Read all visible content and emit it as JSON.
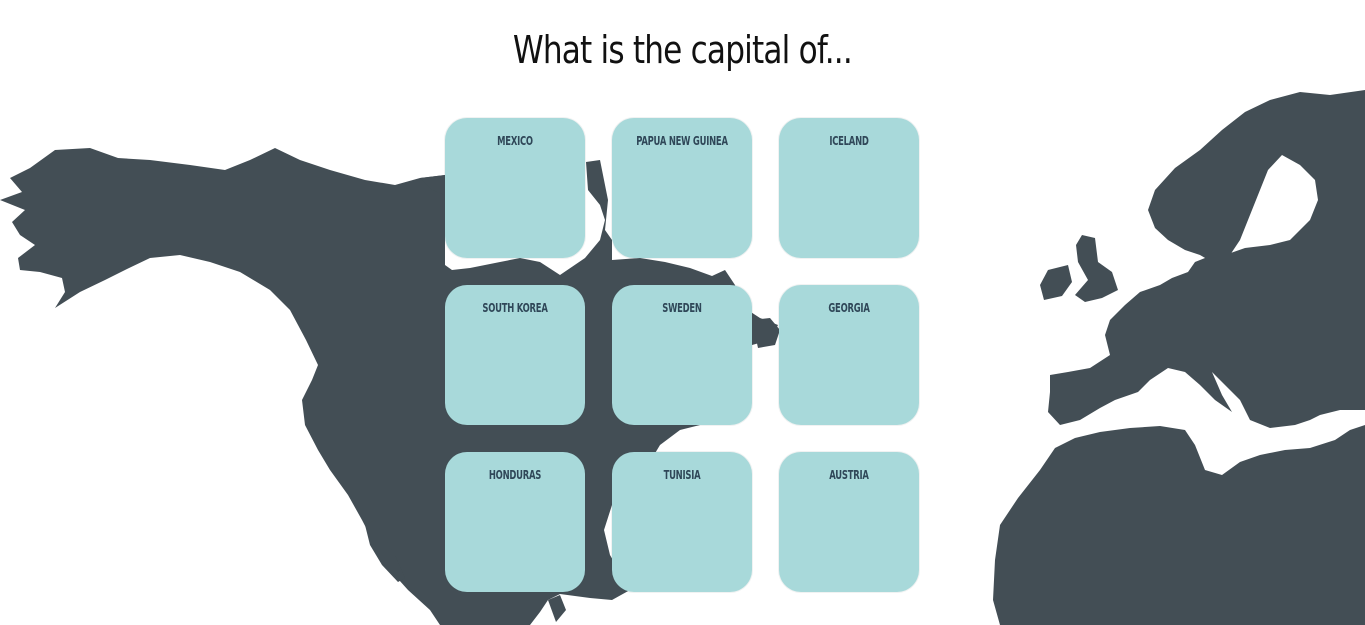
{
  "question": {
    "title": "What is the capital of..."
  },
  "countries": [
    "Mexico",
    "Papua New Guinea",
    "Iceland",
    "South Korea",
    "Sweden",
    "Georgia",
    "Honduras",
    "Tunisia",
    "Austria"
  ],
  "colors": {
    "map": "#434e55",
    "card": "#a8d9da",
    "card_text": "#2f4758",
    "background": "#ffffff",
    "title": "#111111"
  }
}
